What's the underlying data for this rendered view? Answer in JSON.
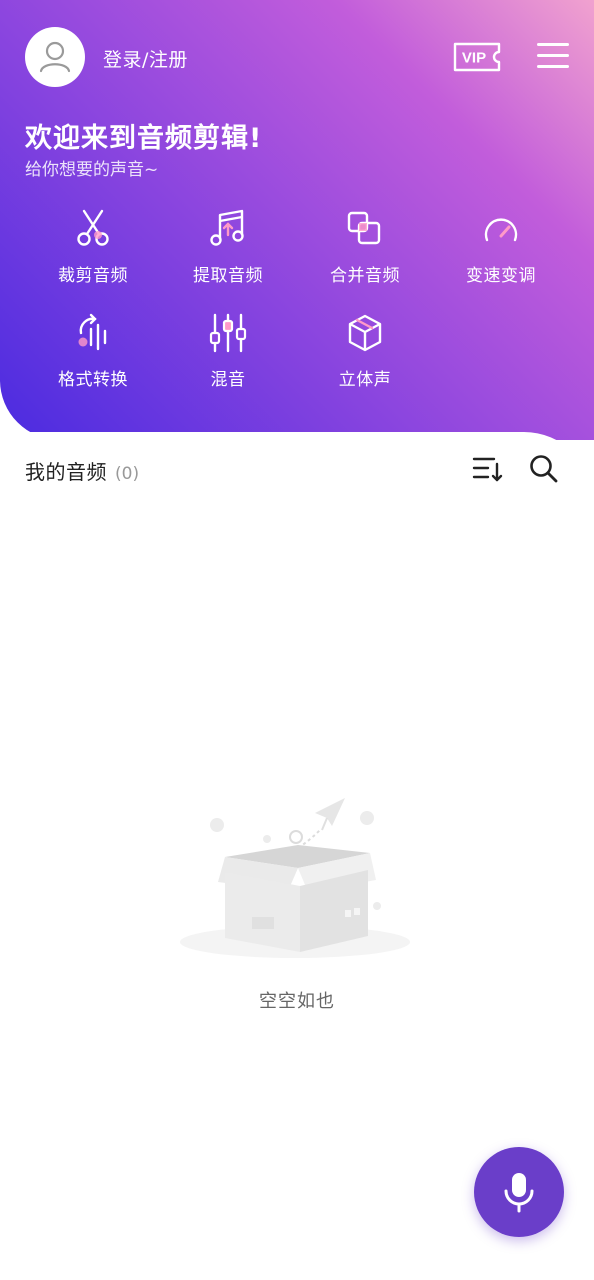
{
  "header": {
    "login_label": "登录/注册",
    "vip_label": "VIP",
    "title": "欢迎来到音频剪辑!",
    "subtitle": "给你想要的声音~"
  },
  "tools": [
    {
      "label": "裁剪音频",
      "icon": "scissors-icon"
    },
    {
      "label": "提取音频",
      "icon": "music-note-icon"
    },
    {
      "label": "合并音频",
      "icon": "merge-icon"
    },
    {
      "label": "变速变调",
      "icon": "speedometer-icon"
    },
    {
      "label": "格式转换",
      "icon": "format-convert-icon"
    },
    {
      "label": "混音",
      "icon": "mixer-sliders-icon"
    },
    {
      "label": "立体声",
      "icon": "cube-icon"
    }
  ],
  "my_audio": {
    "title": "我的音频",
    "count": "(0)"
  },
  "empty_state": {
    "text": "空空如也"
  },
  "colors": {
    "gradient_start": "#4a2be0",
    "gradient_mid": "#c25ddb",
    "gradient_end": "#f1a2cf",
    "fab": "#6a3ec9"
  }
}
